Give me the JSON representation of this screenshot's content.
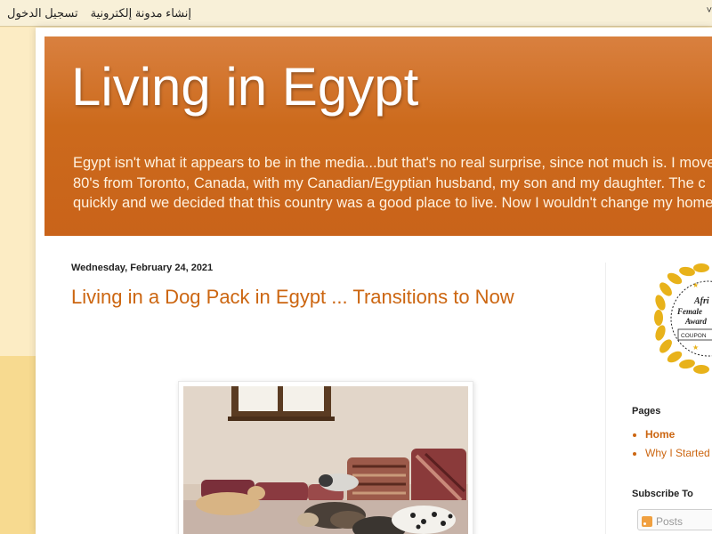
{
  "navbar": {
    "create_blog": "إنشاء مدونة إلكترونية",
    "sign_in": "تسجيل الدخول",
    "caret": "˅"
  },
  "header": {
    "title": "Living in Egypt",
    "description_lines": [
      "Egypt isn't what it appears to be in the media...but that's no real surprise, since not much is. I moved",
      "80's from Toronto, Canada, with my Canadian/Egyptian husband, my son and my daughter. The c",
      "quickly and we decided that this country was a good place to live. Now I wouldn't change my home"
    ]
  },
  "post": {
    "date": "Wednesday, February 24, 2021",
    "title": "Living in a Dog Pack in Egypt ... Transitions to Now"
  },
  "sidebar": {
    "award_lines": [
      "Afri",
      "Female",
      "Award",
      "COUPON"
    ],
    "pages_title": "Pages",
    "pages": [
      "Home",
      "Why I Started"
    ],
    "subscribe_title": "Subscribe To",
    "subscribe_posts": "Posts"
  },
  "colors": {
    "accent": "#cc6611",
    "header_orange": "#cc6a1c",
    "page_bg": "#fbe7b5"
  }
}
